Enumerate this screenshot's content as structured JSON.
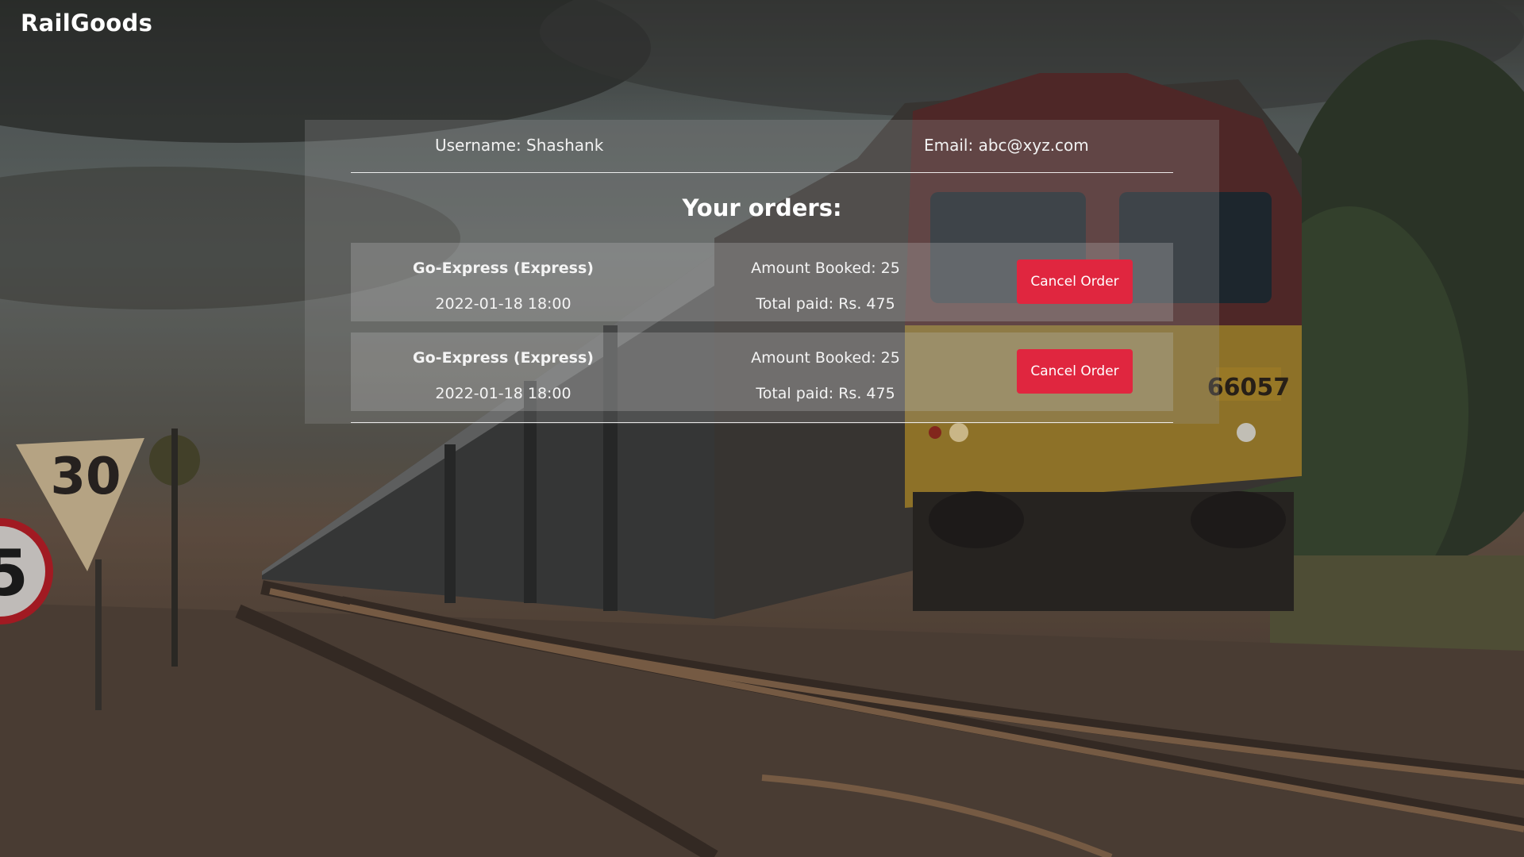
{
  "app": {
    "brand": "RailGoods"
  },
  "user": {
    "username_text": "Username: Shashank",
    "email_text": "Email: abc@xyz.com"
  },
  "orders_title": "Your orders:",
  "orders": [
    {
      "train": "Go-Express (Express)",
      "datetime": "2022-01-18 18:00",
      "amount_booked": "Amount Booked: 25",
      "total_paid": "Total paid: Rs. 475",
      "cancel_label": "Cancel Order"
    },
    {
      "train": "Go-Express (Express)",
      "datetime": "2022-01-18 18:00",
      "amount_booked": "Amount Booked: 25",
      "total_paid": "Total paid: Rs. 475",
      "cancel_label": "Cancel Order"
    }
  ],
  "background": {
    "locomotive_number": "66057",
    "speed_sign": "30",
    "speed_sign_partial": "5"
  },
  "colors": {
    "cancel_button": "#e0263f",
    "panel_overlay": "rgba(150,150,150,0.27)"
  }
}
